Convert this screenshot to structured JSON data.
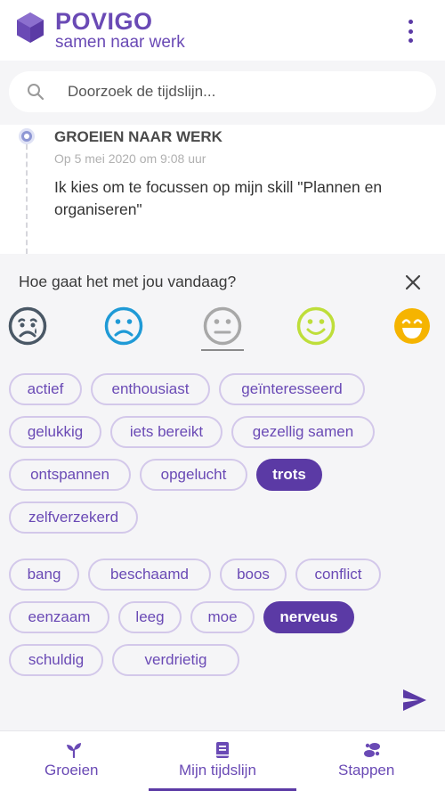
{
  "header": {
    "brand_name": "POVIGO",
    "tagline": "samen naar werk",
    "logo_icon": "hexagon-logo-icon",
    "menu_icon": "more-vertical-icon"
  },
  "search": {
    "placeholder": "Doorzoek de tijdslijn...",
    "icon": "search-icon"
  },
  "timeline": {
    "entry": {
      "title": "GROEIEN NAAR WERK",
      "date": "Op 5 mei 2020 om 9:08 uur",
      "text": "Ik kies om te focussen op mijn skill \"Plannen en organiseren\""
    }
  },
  "mood": {
    "question": "Hoe gaat het met jou vandaag?",
    "close_icon": "close-icon",
    "faces": [
      {
        "name": "very-sad",
        "color": "#4a5866"
      },
      {
        "name": "sad",
        "color": "#1f9ad6"
      },
      {
        "name": "neutral",
        "color": "#a8a8a8",
        "selected": true
      },
      {
        "name": "happy",
        "color": "#bede3a"
      },
      {
        "name": "very-happy",
        "color": "#f5b400"
      }
    ],
    "positive_feelings": [
      {
        "label": "actief",
        "active": false
      },
      {
        "label": "enthousiast",
        "active": false
      },
      {
        "label": "geïnteresseerd",
        "active": false
      },
      {
        "label": "gelukkig",
        "active": false
      },
      {
        "label": "iets bereikt",
        "active": false
      },
      {
        "label": "gezellig samen",
        "active": false
      },
      {
        "label": "ontspannen",
        "active": false
      },
      {
        "label": "opgelucht",
        "active": false
      },
      {
        "label": "trots",
        "active": true
      },
      {
        "label": "zelfverzekerd",
        "active": false
      }
    ],
    "negative_feelings": [
      {
        "label": "bang",
        "active": false
      },
      {
        "label": "beschaamd",
        "active": false
      },
      {
        "label": "boos",
        "active": false
      },
      {
        "label": "conflict",
        "active": false
      },
      {
        "label": "eenzaam",
        "active": false
      },
      {
        "label": "leeg",
        "active": false
      },
      {
        "label": "moe",
        "active": false
      },
      {
        "label": "nerveus",
        "active": true
      },
      {
        "label": "schuldig",
        "active": false
      },
      {
        "label": "verdrietig",
        "active": false
      }
    ],
    "send_icon": "send-icon"
  },
  "bottom_nav": [
    {
      "label": "Groeien",
      "icon": "sprout-icon",
      "active": false
    },
    {
      "label": "Mijn tijdslijn",
      "icon": "book-icon",
      "active": true
    },
    {
      "label": "Stappen",
      "icon": "footsteps-icon",
      "active": false
    }
  ],
  "colors": {
    "brand": "#6a4ab5",
    "brand_dark": "#5b3aa5",
    "chip_border": "#d3c8ea"
  }
}
